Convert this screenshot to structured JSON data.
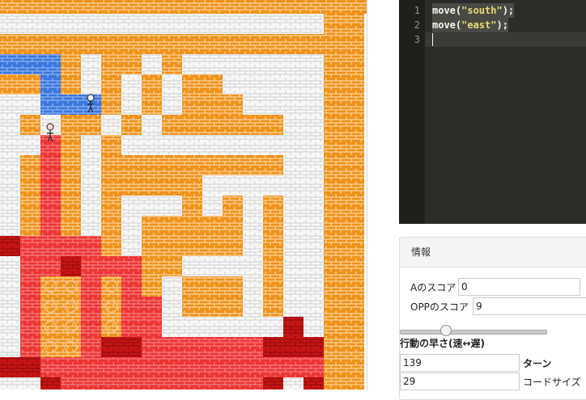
{
  "board": {
    "cols": 18,
    "rows": 19,
    "grid": [
      "wwwwwwwwwwwwwwwwoo",
      "oooooooooooooooooo",
      "BBBowoowowwwwwwwoo",
      "ooBowowowoowwwwwoo",
      "wwBBBowowooowwwwoo",
      "wowoowowoooooowwoo",
      "wwRowowwwwwwwwwwoo",
      "woRowooooooooowwoo",
      "woRowooooowwwwwwoo",
      "woRowowwwowowowwoo",
      "woRowowooooowowwoo",
      "dRRRRowooooowowwoo",
      "wRRDRRRoowwwwowwoo",
      "wRccRcRowooowowwoo",
      "wRccRcRRwooowowwoo",
      "wRccRcRRwwwwwwDwoo",
      "wRccRDDRRRRRRDDDoo",
      "dDRRRRRRRRRRRRRRoo",
      "wwDRRRRRRRRRRDwDoo"
    ],
    "colors": {
      "white_fill": "#f7f7f7",
      "orange_fill": "#f0921b",
      "blue_fill": "#3b76e0",
      "red_fill": "#ee3535",
      "dark_red_fill": "#c41515",
      "coin": "#f6c28a"
    },
    "player_a_icon": "figure-a-icon",
    "player_opp_icon": "figure-opp-icon"
  },
  "editor": {
    "lines": [
      {
        "number": "1",
        "fn": "move(",
        "str": "\"south\"",
        "end": ");"
      },
      {
        "number": "2",
        "fn": "move(",
        "str": "\"east\"",
        "end": ");"
      },
      {
        "number": "3",
        "fn": "",
        "str": "",
        "end": ""
      }
    ],
    "colors": {
      "background": "#2b2b29",
      "string": "#e6db74"
    }
  },
  "info": {
    "title": "情報",
    "score_a_label": "Aのスコア",
    "score_a_value": "0",
    "score_opp_label": "OPPのスコア",
    "score_opp_value": "9",
    "speed_label": "行動の早さ(速↔遅)",
    "speed_level": 0.3,
    "turn_value": "139",
    "turn_label": "ターン",
    "code_size_value": "29",
    "code_size_label": "コードサイズ"
  }
}
